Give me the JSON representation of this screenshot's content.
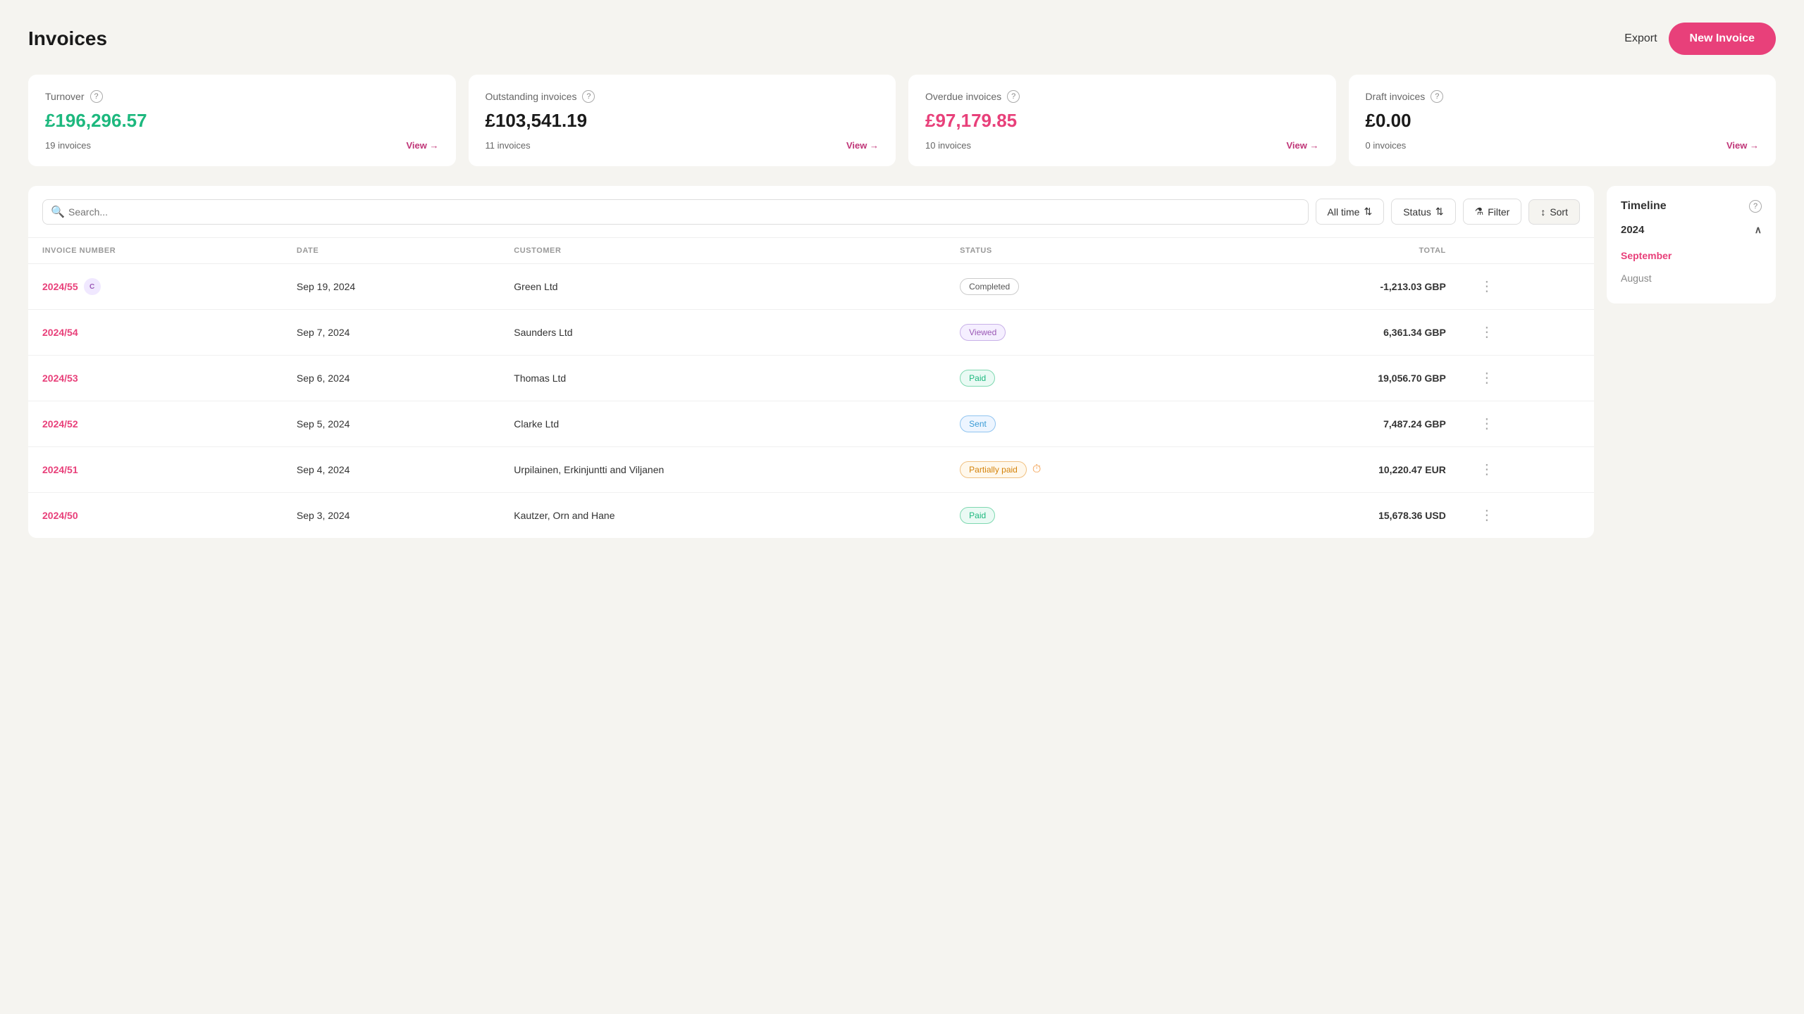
{
  "header": {
    "title": "Invoices",
    "export_label": "Export",
    "new_invoice_label": "New Invoice"
  },
  "stats": [
    {
      "id": "turnover",
      "label": "Turnover",
      "value": "£196,296.57",
      "value_class": "green",
      "count": "19 invoices",
      "view_label": "View →"
    },
    {
      "id": "outstanding",
      "label": "Outstanding invoices",
      "value": "£103,541.19",
      "value_class": "black",
      "count": "11 invoices",
      "view_label": "View →"
    },
    {
      "id": "overdue",
      "label": "Overdue invoices",
      "value": "£97,179.85",
      "value_class": "red",
      "count": "10 invoices",
      "view_label": "View →"
    },
    {
      "id": "draft",
      "label": "Draft invoices",
      "value": "£0.00",
      "value_class": "black",
      "count": "0 invoices",
      "view_label": "View →"
    }
  ],
  "toolbar": {
    "search_placeholder": "Search...",
    "time_filter": "All time",
    "status_filter": "Status",
    "filter_label": "Filter",
    "sort_label": "Sort"
  },
  "table": {
    "columns": [
      "INVOICE NUMBER",
      "DATE",
      "CUSTOMER",
      "STATUS",
      "TOTAL"
    ],
    "rows": [
      {
        "number": "2024/55",
        "has_avatar": true,
        "avatar_letter": "C",
        "date": "Sep 19, 2024",
        "customer": "Green Ltd",
        "status": "Completed",
        "status_class": "status-completed",
        "total": "-1,213.03 GBP",
        "has_clock": false
      },
      {
        "number": "2024/54",
        "has_avatar": false,
        "date": "Sep 7, 2024",
        "customer": "Saunders Ltd",
        "status": "Viewed",
        "status_class": "status-viewed",
        "total": "6,361.34 GBP",
        "has_clock": false
      },
      {
        "number": "2024/53",
        "has_avatar": false,
        "date": "Sep 6, 2024",
        "customer": "Thomas Ltd",
        "status": "Paid",
        "status_class": "status-paid",
        "total": "19,056.70 GBP",
        "has_clock": false
      },
      {
        "number": "2024/52",
        "has_avatar": false,
        "date": "Sep 5, 2024",
        "customer": "Clarke Ltd",
        "status": "Sent",
        "status_class": "status-sent",
        "total": "7,487.24 GBP",
        "has_clock": false
      },
      {
        "number": "2024/51",
        "has_avatar": false,
        "date": "Sep 4, 2024",
        "customer": "Urpilainen, Erkinjuntti and Viljanen",
        "status": "Partially paid",
        "status_class": "status-partial",
        "total": "10,220.47 EUR",
        "has_clock": true
      },
      {
        "number": "2024/50",
        "has_avatar": false,
        "date": "Sep 3, 2024",
        "customer": "Kautzer, Orn and Hane",
        "status": "Paid",
        "status_class": "status-paid",
        "total": "15,678.36 USD",
        "has_clock": false
      }
    ]
  },
  "timeline": {
    "title": "Timeline",
    "year": "2024",
    "months": [
      {
        "label": "September",
        "active": true
      },
      {
        "label": "August",
        "active": false
      }
    ]
  }
}
